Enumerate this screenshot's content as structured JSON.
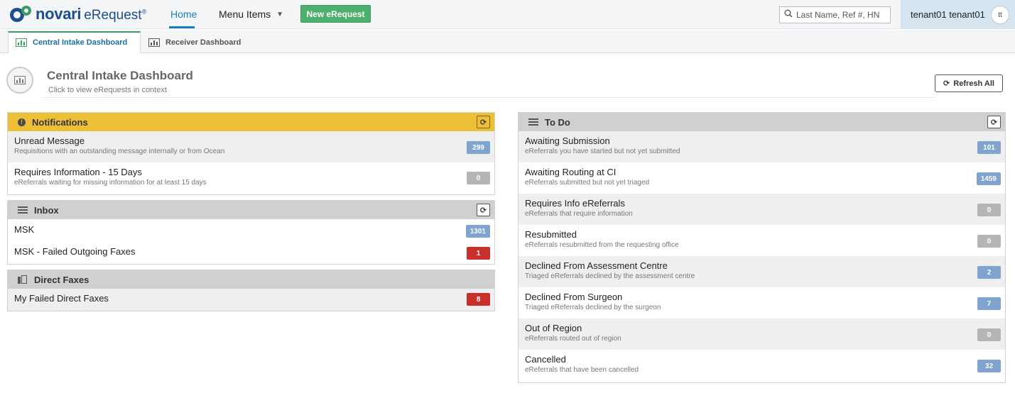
{
  "app": {
    "logo_brand": "novari",
    "logo_product": "eRequest",
    "logo_tm": "®"
  },
  "nav": {
    "home": "Home",
    "menu_items": "Menu Items",
    "new_erequest": "New eRequest"
  },
  "search": {
    "placeholder": "Last Name, Ref #, HN"
  },
  "user": {
    "name": "tenant01 tenant01",
    "initials": "tt"
  },
  "tabs": [
    {
      "label": "Central Intake Dashboard",
      "active": true
    },
    {
      "label": "Receiver Dashboard",
      "active": false
    }
  ],
  "dashboard": {
    "title": "Central Intake Dashboard",
    "subtitle": "Click to view eRequests in context",
    "refresh_all": "Refresh All"
  },
  "notifications": {
    "title": "Notifications",
    "icon": "exclamation-circle-icon",
    "rows": [
      {
        "title": "Unread Message",
        "desc": "Requisitions with an outstanding message internally or from Ocean",
        "count": "299",
        "badge_color": "blue"
      },
      {
        "title": "Requires Information - 15 Days",
        "desc": "eReferrals waiting for missing information for at least 15 days",
        "count": "0",
        "badge_color": "grey"
      }
    ]
  },
  "inbox": {
    "title": "Inbox",
    "icon": "list-icon",
    "rows": [
      {
        "title": "MSK",
        "count": "1301",
        "badge_color": "blue"
      },
      {
        "title": "MSK - Failed Outgoing Faxes",
        "count": "1",
        "badge_color": "red"
      }
    ]
  },
  "direct_faxes": {
    "title": "Direct Faxes",
    "icon": "fax-icon",
    "rows": [
      {
        "title": "My Failed Direct Faxes",
        "count": "8",
        "badge_color": "red"
      }
    ]
  },
  "todo": {
    "title": "To Do",
    "icon": "list-icon",
    "rows": [
      {
        "title": "Awaiting Submission",
        "desc": "eReferrals you have started but not yet submitted",
        "count": "101",
        "badge_color": "blue"
      },
      {
        "title": "Awaiting Routing at CI",
        "desc": "eReferrals submitted but not yet triaged",
        "count": "1459",
        "badge_color": "blue"
      },
      {
        "title": "Requires Info eReferrals",
        "desc": "eReferrals that require information",
        "count": "0",
        "badge_color": "grey"
      },
      {
        "title": "Resubmitted",
        "desc": "eReferrals resubmitted from the requesting office",
        "count": "0",
        "badge_color": "grey"
      },
      {
        "title": "Declined From Assessment Centre",
        "desc": "Triaged eReferrals declined by the assessment centre",
        "count": "2",
        "badge_color": "blue"
      },
      {
        "title": "Declined From Surgeon",
        "desc": "Triaged eReferrals declined by the surgeon",
        "count": "7",
        "badge_color": "blue"
      },
      {
        "title": "Out of Region",
        "desc": "eReferrals routed out of region",
        "count": "0",
        "badge_color": "grey"
      },
      {
        "title": "Cancelled",
        "desc": "eReferrals that have been cancelled",
        "count": "32",
        "badge_color": "blue"
      }
    ]
  },
  "colors": {
    "accent": "#1a7fb9",
    "new_button": "#4caf6d",
    "notifications_header": "#ecbf36",
    "panel_header": "#cfd0d2",
    "badge_blue": "#7fa5cf",
    "badge_grey": "#b4b5b7",
    "badge_red": "#c9302c"
  }
}
